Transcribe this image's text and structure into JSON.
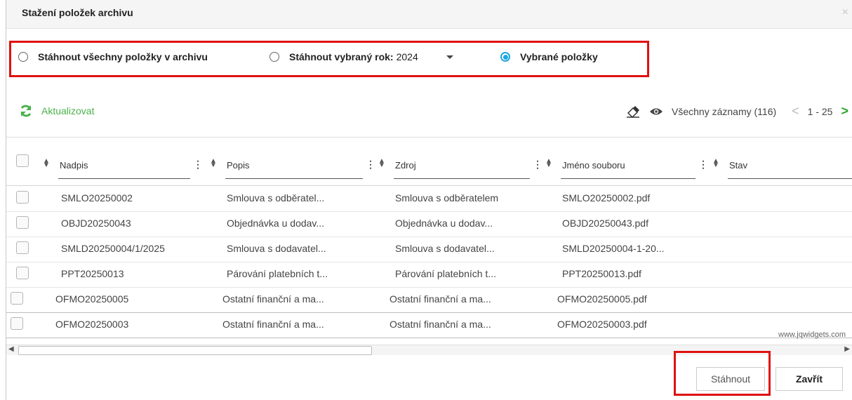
{
  "dialog": {
    "title": "Stažení položek archivu",
    "close_icon": "×"
  },
  "options": {
    "all": "Stáhnout všechny položky v archivu",
    "year_label": "Stáhnout vybraný rok:",
    "year_value": "2024",
    "selected": "Vybrané položky",
    "checked": "selected"
  },
  "toolbar": {
    "refresh": "Aktualizovat",
    "records": "Všechny záznamy (116)",
    "page_range": "1 - 25",
    "prev": "<",
    "next": ">"
  },
  "columns": [
    "Nadpis",
    "Popis",
    "Zdroj",
    "Jméno souboru",
    "Stav"
  ],
  "rows": [
    [
      "SMLO20250002",
      "Smlouva s odběratel...",
      "Smlouva s odběratelem",
      "SMLO20250002.pdf",
      ""
    ],
    [
      "OBJD20250043",
      "Objednávka u dodav...",
      "Objednávka u dodav...",
      "OBJD20250043.pdf",
      ""
    ],
    [
      "SMLD20250004/1/2025",
      "Smlouva s dodavatel...",
      "Smlouva s dodavatel...",
      "SMLD20250004-1-20...",
      ""
    ],
    [
      "PPT20250013",
      "Párování platebních t...",
      "Párování platebních t...",
      "PPT20250013.pdf",
      ""
    ],
    [
      "OFMO20250005",
      "Ostatní finanční a ma...",
      "Ostatní finanční a ma...",
      "OFMO20250005.pdf",
      ""
    ],
    [
      "OFMO20250003",
      "Ostatní finanční a ma...",
      "Ostatní finanční a ma...",
      "OFMO20250003.pdf",
      ""
    ]
  ],
  "watermark": "www.jqwidgets.com",
  "buttons": {
    "download": "Stáhnout",
    "close": "Zavřít"
  },
  "colors": {
    "accent": "#1ea7e1",
    "green": "#4bb24b",
    "highlight": "#e01010"
  }
}
